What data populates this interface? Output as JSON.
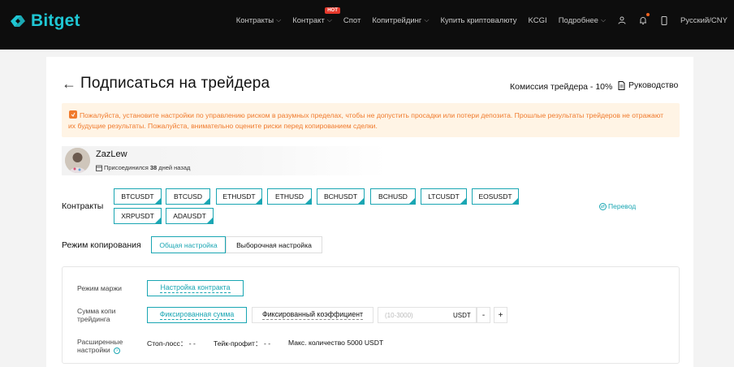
{
  "brand": {
    "name": "Bitget",
    "accent": "#1fc7d4",
    "teal": "#1aa6b3",
    "warning": "#f07a2c"
  },
  "nav": {
    "items": [
      {
        "label": "Контракты",
        "has_dropdown": true
      },
      {
        "label": "Контракт",
        "has_dropdown": true,
        "badge": "HOT"
      },
      {
        "label": "Спот",
        "has_dropdown": false
      },
      {
        "label": "Копитрейдинг",
        "has_dropdown": true
      },
      {
        "label": "Купить криптовалюту",
        "has_dropdown": false
      },
      {
        "label": "KCGI",
        "has_dropdown": false
      },
      {
        "label": "Подробнее",
        "has_dropdown": true
      }
    ],
    "language": "Русский/CNY"
  },
  "page": {
    "title": "Подписаться на трейдера",
    "commission": "Комиссия трейдера - 10%",
    "guide": "Руководство",
    "warning": "Пожалуйста, установите настройки по управлению риском в разумных пределах, чтобы не допустить просадки или потери депозита. Прошлые результаты трейдеров не отражают их будущие результаты. Пожалуйста, внимательно оцените риски перед копированием сделки."
  },
  "trader": {
    "name": "ZazLew",
    "joined_prefix": "Присоединился",
    "joined_days": "38",
    "joined_suffix": "дней назад"
  },
  "contracts": {
    "label": "Контракты",
    "items": [
      "BTCUSDT",
      "BTCUSD",
      "ETHUSDT",
      "ETHUSD",
      "BCHUSDT",
      "BCHUSD",
      "LTCUSDT",
      "EOSUSDT",
      "XRPUSDT",
      "ADAUSDT"
    ],
    "transfer": "Перевод"
  },
  "copy_mode": {
    "label": "Режим копирования",
    "options": [
      "Общая настройка",
      "Выборочная настройка"
    ],
    "selected": "Общая настройка"
  },
  "settings": {
    "margin_label": "Режим маржи",
    "margin_button": "Настройка контракта",
    "amount_label": "Сумма копи трейдинга",
    "amount_fixed": "Фиксированная сумма",
    "amount_ratio": "Фиксированный коэффициент",
    "amount_placeholder": "(10-3000)",
    "amount_unit": "USDT",
    "minus": "-",
    "plus": "+",
    "advanced_label": "Расширенные настройки",
    "stop_loss": "Стоп-лосс： - -",
    "take_profit": "Тейк-профит： - -",
    "max_amount": "Макс. количество 5000 USDT"
  }
}
